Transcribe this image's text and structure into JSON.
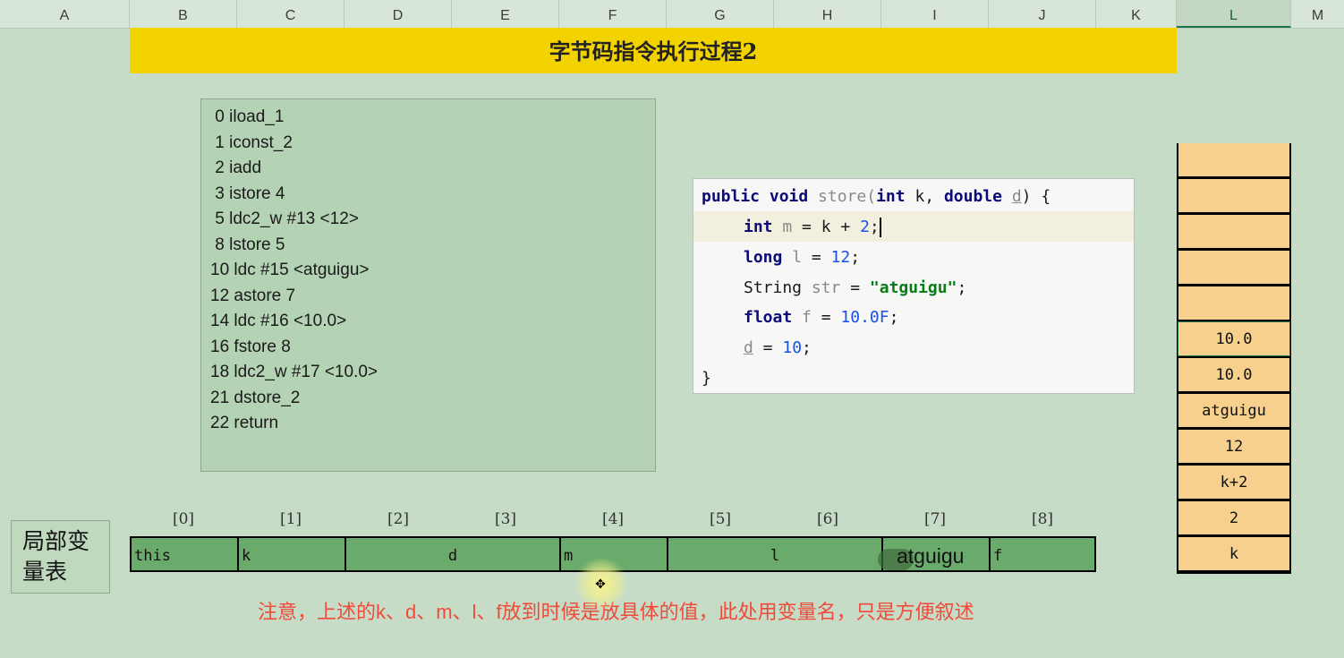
{
  "columns": [
    "A",
    "B",
    "C",
    "D",
    "E",
    "F",
    "G",
    "H",
    "I",
    "J",
    "K",
    "L",
    "M"
  ],
  "title": "字节码指令执行过程2",
  "bytecode": [
    " 0 iload_1",
    " 1 iconst_2",
    " 2 iadd",
    " 3 istore 4",
    " 5 ldc2_w #13 <12>",
    " 8 lstore 5",
    "10 ldc #15 <atguigu>",
    "12 astore 7",
    "14 ldc #16 <10.0>",
    "16 fstore 8",
    "18 ldc2_w #17 <10.0>",
    "21 dstore_2",
    "22 return"
  ],
  "code": {
    "line1": {
      "kw1": "public void ",
      "method": "store(",
      "kw2": "int ",
      "p1": "k, ",
      "kw3": "double ",
      "p2": "d",
      "end": ") {"
    },
    "line2": {
      "kw": "int ",
      "var": "m",
      "rest": " = k + ",
      "num": "2",
      "end": ";"
    },
    "line3": {
      "kw": "long ",
      "var": "l",
      "rest": " = ",
      "num": "12",
      "end": ";"
    },
    "line4": {
      "type": "String ",
      "var": "str",
      "rest": " = ",
      "str": "\"atguigu\"",
      "end": ";"
    },
    "line5": {
      "kw": "float ",
      "var": "f",
      "rest": " = ",
      "num": "10.0F",
      "end": ";"
    },
    "line6": {
      "var": "d",
      "rest": " = ",
      "num": "10",
      "end": ";"
    },
    "line7": "}"
  },
  "operand_stack": [
    "",
    "",
    "",
    "",
    "",
    "10.0",
    "10.0",
    "atguigu",
    "12",
    "k+2",
    "2",
    "k"
  ],
  "local_var_table": {
    "label": "局部变量表",
    "indices": [
      "[0]",
      "[1]",
      "[2]",
      "[3]",
      "[4]",
      "[5]",
      "[6]",
      "[7]",
      "[8]"
    ],
    "cells": [
      "this",
      "k",
      "d",
      "m",
      "l",
      "atguigu",
      "f"
    ]
  },
  "note": "注意，上述的k、d、m、l、f放到时候是放具体的值，此处用变量名，只是方便叙述"
}
